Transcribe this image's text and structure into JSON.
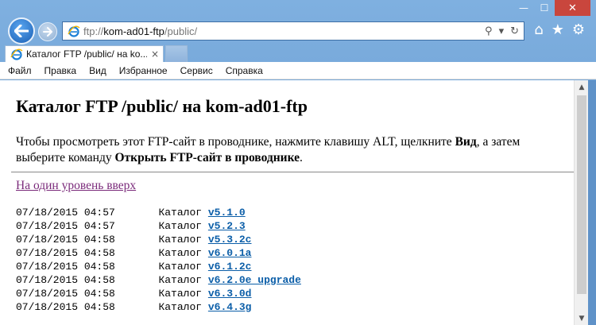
{
  "window": {
    "minimize": "—",
    "maximize": "☐",
    "close": "✕"
  },
  "address": {
    "prefix": "ftp://",
    "host": "kom-ad01-ftp",
    "path": "/public/"
  },
  "tab": {
    "title": "Каталог FTP /public/ на ko...",
    "close": "×"
  },
  "menu": [
    "Файл",
    "Правка",
    "Вид",
    "Избранное",
    "Сервис",
    "Справка"
  ],
  "page": {
    "title": "Каталог FTP /public/ на kom-ad01-ftp",
    "intro_1": "Чтобы просмотреть этот FTP-сайт в проводнике, нажмите клавишу ALT, щелкните ",
    "intro_bold_1": "Вид",
    "intro_2": ", а затем выберите команду ",
    "intro_bold_2": "Открыть FTP-сайт в проводнике",
    "intro_3": ".",
    "up_link": "На один уровень вверх"
  },
  "listing": [
    {
      "date": "07/18/2015",
      "time": "04:57",
      "type": "Каталог",
      "name": "v5.1.0"
    },
    {
      "date": "07/18/2015",
      "time": "04:57",
      "type": "Каталог",
      "name": "v5.2.3"
    },
    {
      "date": "07/18/2015",
      "time": "04:58",
      "type": "Каталог",
      "name": "v5.3.2c"
    },
    {
      "date": "07/18/2015",
      "time": "04:58",
      "type": "Каталог",
      "name": "v6.0.1a"
    },
    {
      "date": "07/18/2015",
      "time": "04:58",
      "type": "Каталог",
      "name": "v6.1.2c"
    },
    {
      "date": "07/18/2015",
      "time": "04:58",
      "type": "Каталог",
      "name": "v6.2.0e_upgrade"
    },
    {
      "date": "07/18/2015",
      "time": "04:58",
      "type": "Каталог",
      "name": "v6.3.0d"
    },
    {
      "date": "07/18/2015",
      "time": "04:58",
      "type": "Каталог",
      "name": "v6.4.3g"
    }
  ],
  "colors": {
    "frame": "#6f9fd1",
    "link_visited": "#7b2b7b",
    "link_dir": "#0b5ea8",
    "close_button": "#c9463d"
  }
}
